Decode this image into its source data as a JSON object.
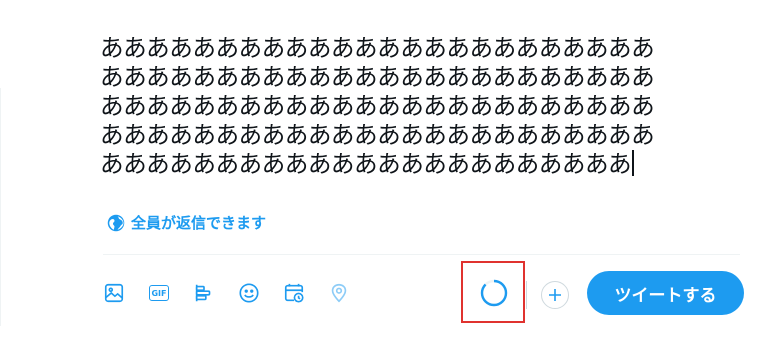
{
  "composer": {
    "text_lines": [
      "ああああああああああああああああああああああああ",
      "ああああああああああああああああああああああああ",
      "ああああああああああああああああああああああああ",
      "ああああああああああああああああああああああああ",
      "あああああああああああああああああああああああ"
    ]
  },
  "reply_setting": {
    "label": "全員が返信できます",
    "icon": "globe-icon"
  },
  "toolbar": {
    "tools": [
      {
        "name": "image-icon"
      },
      {
        "name": "gif-icon",
        "label": "GIF"
      },
      {
        "name": "poll-icon"
      },
      {
        "name": "emoji-icon"
      },
      {
        "name": "schedule-icon"
      },
      {
        "name": "location-icon"
      }
    ]
  },
  "char_progress": {
    "fraction_used": 0.87
  },
  "tweet_button": {
    "label": "ツイートする"
  },
  "colors": {
    "accent": "#1d9bf0",
    "text": "#0f1419",
    "highlight": "#e0322f",
    "border": "#eff3f4"
  }
}
